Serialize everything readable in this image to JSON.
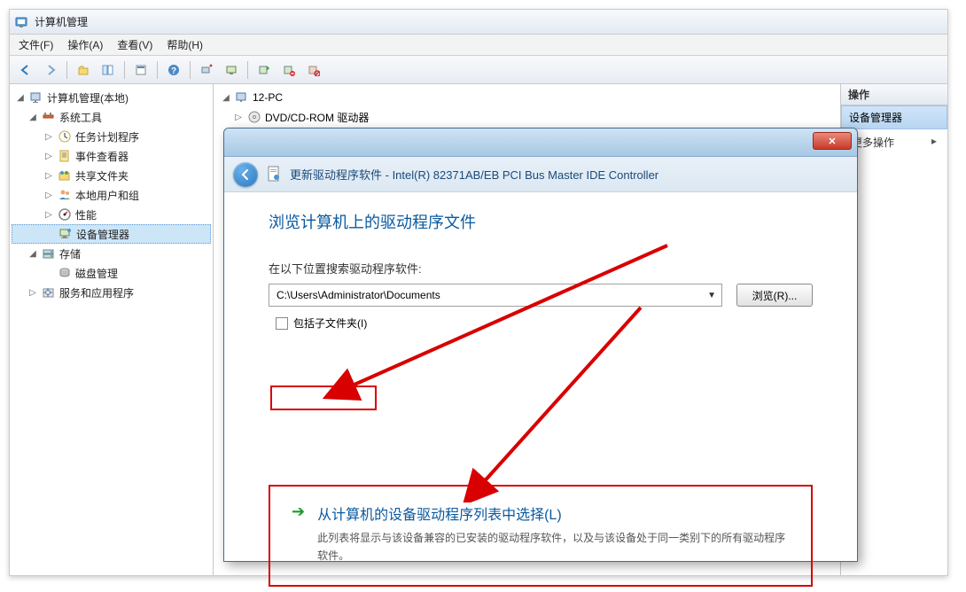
{
  "window": {
    "title": "计算机管理"
  },
  "menu": {
    "file": "文件(F)",
    "action": "操作(A)",
    "view": "查看(V)",
    "help": "帮助(H)"
  },
  "tree": {
    "root": "计算机管理(本地)",
    "system_tools": "系统工具",
    "task_scheduler": "任务计划程序",
    "event_viewer": "事件查看器",
    "shared_folders": "共享文件夹",
    "local_users": "本地用户和组",
    "performance": "性能",
    "device_manager": "设备管理器",
    "storage": "存储",
    "disk_mgmt": "磁盘管理",
    "services_apps": "服务和应用程序"
  },
  "mid": {
    "pc_node": "12-PC",
    "dvd_node": "DVD/CD-ROM 驱动器"
  },
  "right": {
    "header": "操作",
    "selected": "设备管理器",
    "more": "更多操作"
  },
  "dialog": {
    "title_prefix": "更新驱动程序软件 - ",
    "device": "Intel(R) 82371AB/EB PCI Bus Master IDE Controller",
    "heading": "浏览计算机上的驱动程序文件",
    "path_label": "在以下位置搜索驱动程序软件:",
    "path_value": "C:\\Users\\Administrator\\Documents",
    "browse_btn": "浏览(R)...",
    "include_sub": "包括子文件夹(I)",
    "option_title": "从计算机的设备驱动程序列表中选择(L)",
    "option_desc": "此列表将显示与该设备兼容的已安装的驱动程序软件，以及与该设备处于同一类别下的所有驱动程序软件。",
    "close_glyph": "✕"
  }
}
